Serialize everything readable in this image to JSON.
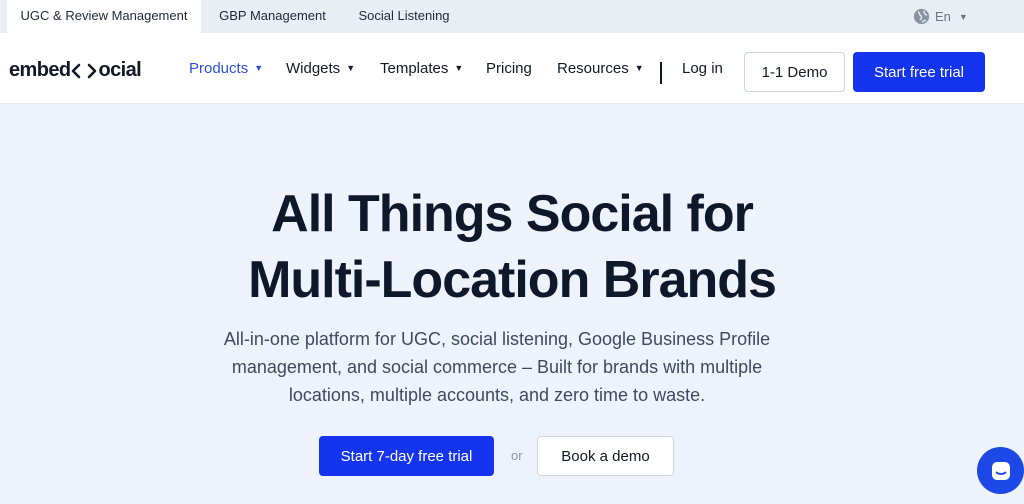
{
  "topbar": {
    "tabs": [
      {
        "label": "UGC & Review Management"
      },
      {
        "label": "GBP Management"
      },
      {
        "label": "Social Listening"
      }
    ],
    "language": "En"
  },
  "nav": {
    "logo_left": "embed",
    "logo_right": "ocial",
    "items": [
      {
        "label": "Products",
        "has_dropdown": true
      },
      {
        "label": "Widgets",
        "has_dropdown": true
      },
      {
        "label": "Templates",
        "has_dropdown": true
      },
      {
        "label": "Pricing",
        "has_dropdown": false
      },
      {
        "label": "Resources",
        "has_dropdown": true
      }
    ],
    "login": "Log in",
    "demo": "1-1 Demo",
    "trial": "Start free trial"
  },
  "hero": {
    "title_line1": "All Things Social for",
    "title_line2": "Multi-Location Brands",
    "subtitle": "All-in-one platform for UGC, social listening, Google Business Profile management, and social commerce – Built for brands with multiple locations, multiple accounts, and zero time to waste.",
    "cta_primary": "Start 7-day free trial",
    "cta_or": "or",
    "cta_secondary": "Book a demo"
  },
  "colors": {
    "primary": "#1434f0",
    "active_nav": "#2b4ee0",
    "hero_bg": "#eef2fa",
    "topbar_bg": "#e9edf4"
  },
  "icons": {
    "language": "globe-icon",
    "dropdown": "chevron-down-icon",
    "chat": "chat-icon"
  }
}
